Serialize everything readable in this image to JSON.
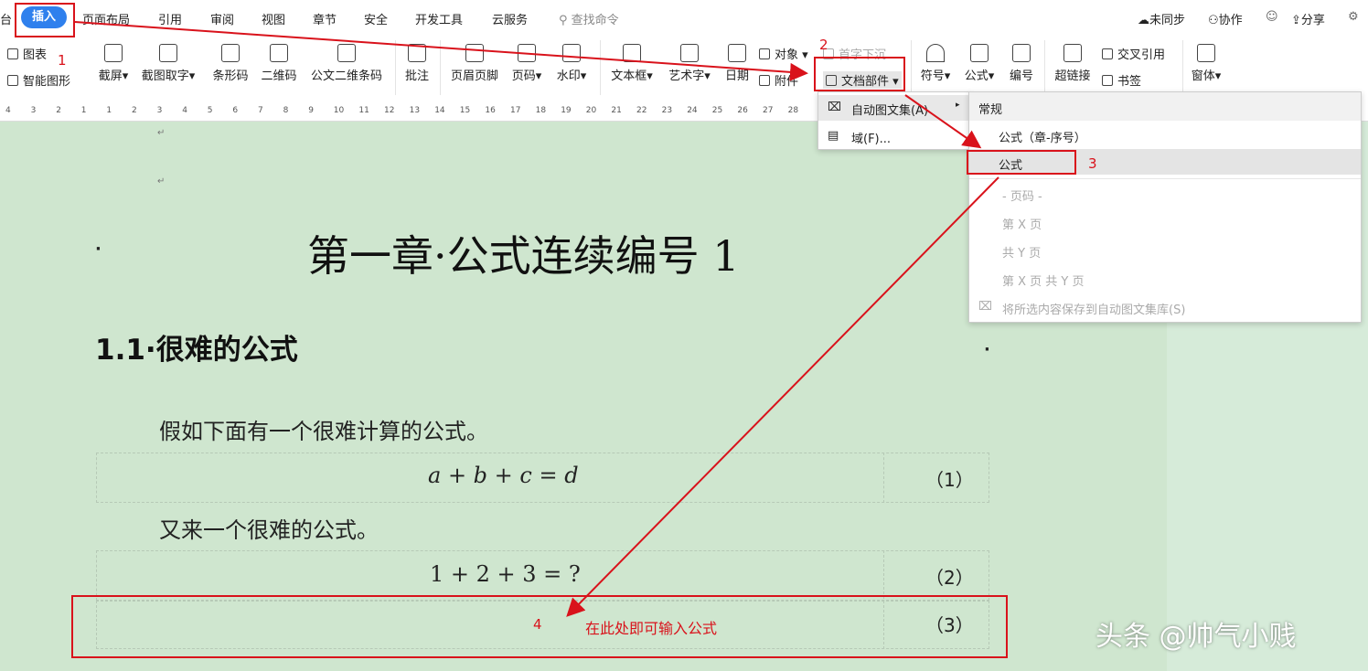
{
  "menubar": {
    "cut_left": "台",
    "active_tab": "插入",
    "tabs": [
      "页面布局",
      "引用",
      "审阅",
      "视图",
      "章节",
      "安全",
      "开发工具",
      "云服务"
    ],
    "search_placeholder": "查找命令",
    "unsynced": "未同步",
    "collab": "协作",
    "share": "分享"
  },
  "ribbon": {
    "chart": "图表",
    "smart_graphic": "智能图形",
    "screenshot": "截屏",
    "ocr": "截图取字",
    "barcode": "条形码",
    "qrcode": "二维码",
    "official_barcode": "公文二维条码",
    "comment": "批注",
    "header_footer": "页眉页脚",
    "page_number": "页码",
    "watermark": "水印",
    "textbox": "文本框",
    "wordart": "艺术字",
    "date": "日期",
    "object": "对象",
    "attachment": "附件",
    "dropcap": "首字下沉",
    "doc_parts": "文档部件",
    "symbol": "符号",
    "formula": "公式",
    "numbering": "编号",
    "hyperlink": "超链接",
    "cross_ref": "交叉引用",
    "bookmark": "书签",
    "window": "窗体"
  },
  "ruler": [
    "4",
    "3",
    "2",
    "1",
    "1",
    "2",
    "3",
    "4",
    "5",
    "6",
    "7",
    "8",
    "9",
    "10",
    "11",
    "12",
    "13",
    "14",
    "15",
    "16",
    "17",
    "18",
    "19",
    "20",
    "21",
    "22",
    "23",
    "24",
    "25",
    "26",
    "27",
    "28"
  ],
  "dropdown1": {
    "autotext": "自动图文集(A)",
    "field": "域(F)..."
  },
  "dropdown2": {
    "header": "常规",
    "items": [
      "公式（章-序号）",
      "公式"
    ],
    "section": "- 页码 -",
    "page_items": [
      "第 X 页",
      "共 Y 页",
      "第 X 页 共 Y 页"
    ],
    "save": "将所选内容保存到自动图文集库(S)"
  },
  "document": {
    "chapter_title": "第一章·公式连续编号 1",
    "section_title": "1.1·很难的公式",
    "para1": "假如下面有一个很难计算的公式。",
    "formula1": "a + b + c = d",
    "num1": "（1）",
    "para2": "又来一个很难的公式。",
    "formula2": "1 + 2 + 3 = ?",
    "num2": "（2）",
    "num3": "（3）",
    "hint": "在此处即可输入公式"
  },
  "annotations": {
    "step1": "1",
    "step2": "2",
    "step3": "3",
    "step4": "4",
    "color": "#d9121b"
  },
  "watermark": "头条 @帅气小贱"
}
